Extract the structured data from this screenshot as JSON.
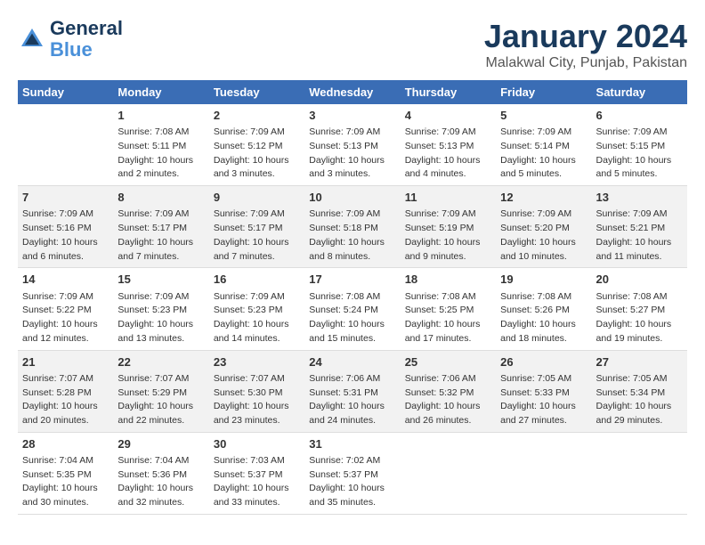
{
  "header": {
    "logo_line1": "General",
    "logo_line2": "Blue",
    "month": "January 2024",
    "location": "Malakwal City, Punjab, Pakistan"
  },
  "days_of_week": [
    "Sunday",
    "Monday",
    "Tuesday",
    "Wednesday",
    "Thursday",
    "Friday",
    "Saturday"
  ],
  "weeks": [
    [
      {
        "day": "",
        "info": ""
      },
      {
        "day": "1",
        "info": "Sunrise: 7:08 AM\nSunset: 5:11 PM\nDaylight: 10 hours\nand 2 minutes."
      },
      {
        "day": "2",
        "info": "Sunrise: 7:09 AM\nSunset: 5:12 PM\nDaylight: 10 hours\nand 3 minutes."
      },
      {
        "day": "3",
        "info": "Sunrise: 7:09 AM\nSunset: 5:13 PM\nDaylight: 10 hours\nand 3 minutes."
      },
      {
        "day": "4",
        "info": "Sunrise: 7:09 AM\nSunset: 5:13 PM\nDaylight: 10 hours\nand 4 minutes."
      },
      {
        "day": "5",
        "info": "Sunrise: 7:09 AM\nSunset: 5:14 PM\nDaylight: 10 hours\nand 5 minutes."
      },
      {
        "day": "6",
        "info": "Sunrise: 7:09 AM\nSunset: 5:15 PM\nDaylight: 10 hours\nand 5 minutes."
      }
    ],
    [
      {
        "day": "7",
        "info": "Sunrise: 7:09 AM\nSunset: 5:16 PM\nDaylight: 10 hours\nand 6 minutes."
      },
      {
        "day": "8",
        "info": "Sunrise: 7:09 AM\nSunset: 5:17 PM\nDaylight: 10 hours\nand 7 minutes."
      },
      {
        "day": "9",
        "info": "Sunrise: 7:09 AM\nSunset: 5:17 PM\nDaylight: 10 hours\nand 7 minutes."
      },
      {
        "day": "10",
        "info": "Sunrise: 7:09 AM\nSunset: 5:18 PM\nDaylight: 10 hours\nand 8 minutes."
      },
      {
        "day": "11",
        "info": "Sunrise: 7:09 AM\nSunset: 5:19 PM\nDaylight: 10 hours\nand 9 minutes."
      },
      {
        "day": "12",
        "info": "Sunrise: 7:09 AM\nSunset: 5:20 PM\nDaylight: 10 hours\nand 10 minutes."
      },
      {
        "day": "13",
        "info": "Sunrise: 7:09 AM\nSunset: 5:21 PM\nDaylight: 10 hours\nand 11 minutes."
      }
    ],
    [
      {
        "day": "14",
        "info": "Sunrise: 7:09 AM\nSunset: 5:22 PM\nDaylight: 10 hours\nand 12 minutes."
      },
      {
        "day": "15",
        "info": "Sunrise: 7:09 AM\nSunset: 5:23 PM\nDaylight: 10 hours\nand 13 minutes."
      },
      {
        "day": "16",
        "info": "Sunrise: 7:09 AM\nSunset: 5:23 PM\nDaylight: 10 hours\nand 14 minutes."
      },
      {
        "day": "17",
        "info": "Sunrise: 7:08 AM\nSunset: 5:24 PM\nDaylight: 10 hours\nand 15 minutes."
      },
      {
        "day": "18",
        "info": "Sunrise: 7:08 AM\nSunset: 5:25 PM\nDaylight: 10 hours\nand 17 minutes."
      },
      {
        "day": "19",
        "info": "Sunrise: 7:08 AM\nSunset: 5:26 PM\nDaylight: 10 hours\nand 18 minutes."
      },
      {
        "day": "20",
        "info": "Sunrise: 7:08 AM\nSunset: 5:27 PM\nDaylight: 10 hours\nand 19 minutes."
      }
    ],
    [
      {
        "day": "21",
        "info": "Sunrise: 7:07 AM\nSunset: 5:28 PM\nDaylight: 10 hours\nand 20 minutes."
      },
      {
        "day": "22",
        "info": "Sunrise: 7:07 AM\nSunset: 5:29 PM\nDaylight: 10 hours\nand 22 minutes."
      },
      {
        "day": "23",
        "info": "Sunrise: 7:07 AM\nSunset: 5:30 PM\nDaylight: 10 hours\nand 23 minutes."
      },
      {
        "day": "24",
        "info": "Sunrise: 7:06 AM\nSunset: 5:31 PM\nDaylight: 10 hours\nand 24 minutes."
      },
      {
        "day": "25",
        "info": "Sunrise: 7:06 AM\nSunset: 5:32 PM\nDaylight: 10 hours\nand 26 minutes."
      },
      {
        "day": "26",
        "info": "Sunrise: 7:05 AM\nSunset: 5:33 PM\nDaylight: 10 hours\nand 27 minutes."
      },
      {
        "day": "27",
        "info": "Sunrise: 7:05 AM\nSunset: 5:34 PM\nDaylight: 10 hours\nand 29 minutes."
      }
    ],
    [
      {
        "day": "28",
        "info": "Sunrise: 7:04 AM\nSunset: 5:35 PM\nDaylight: 10 hours\nand 30 minutes."
      },
      {
        "day": "29",
        "info": "Sunrise: 7:04 AM\nSunset: 5:36 PM\nDaylight: 10 hours\nand 32 minutes."
      },
      {
        "day": "30",
        "info": "Sunrise: 7:03 AM\nSunset: 5:37 PM\nDaylight: 10 hours\nand 33 minutes."
      },
      {
        "day": "31",
        "info": "Sunrise: 7:02 AM\nSunset: 5:37 PM\nDaylight: 10 hours\nand 35 minutes."
      },
      {
        "day": "",
        "info": ""
      },
      {
        "day": "",
        "info": ""
      },
      {
        "day": "",
        "info": ""
      }
    ]
  ]
}
